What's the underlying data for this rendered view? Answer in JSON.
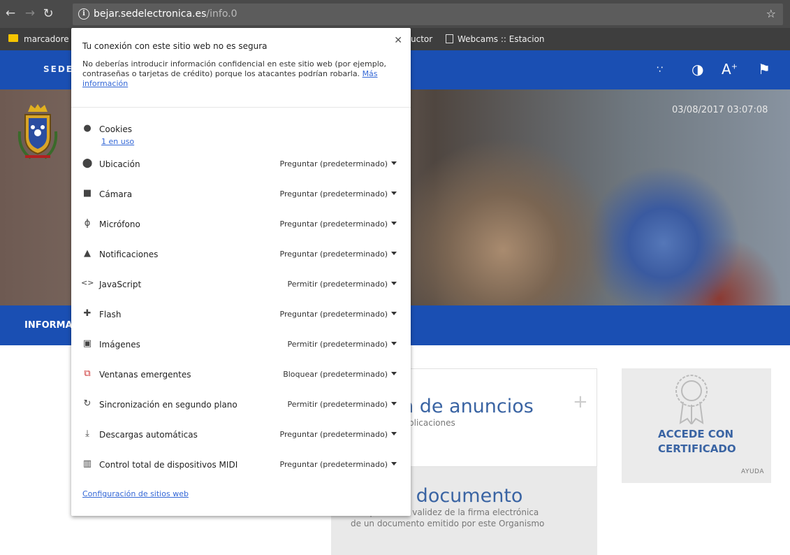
{
  "browser": {
    "url_host": "bejar.sedelectronica.es",
    "url_path": "/info.0",
    "bookmarks": [
      "marcadore",
      "uctor",
      "Webcams :: Estacion"
    ]
  },
  "site": {
    "header_title": "SEDE",
    "datetime": "03/08/2017 03:07:08",
    "nav_label": "INFORMA",
    "card1": {
      "title": "n de anuncios",
      "subtitle": "plicaciones"
    },
    "card2": {
      "title": "r documento",
      "subtitle_line1": "Compruebe la validez de la firma electrónica",
      "subtitle_line2": "de un documento emitido por este Organismo"
    },
    "cert": {
      "line1": "ACCEDE CON",
      "line2": "CERTIFICADO",
      "help": "AYUDA"
    }
  },
  "popup": {
    "title": "Tu conexión con este sitio web no es segura",
    "description": "No deberías introducir información confidencial en este sitio web (por ejemplo, contraseñas o tarjetas de crédito) porque los atacantes podrían robarla.",
    "more_info": "Más información",
    "cookies": {
      "label": "Cookies",
      "sub": "1 en uso"
    },
    "permissions": [
      {
        "label": "Ubicación",
        "value": "Preguntar (predeterminado)",
        "icon": "location-icon"
      },
      {
        "label": "Cámara",
        "value": "Preguntar (predeterminado)",
        "icon": "camera-icon"
      },
      {
        "label": "Micrófono",
        "value": "Preguntar (predeterminado)",
        "icon": "microphone-icon"
      },
      {
        "label": "Notificaciones",
        "value": "Preguntar (predeterminado)",
        "icon": "bell-icon"
      },
      {
        "label": "JavaScript",
        "value": "Permitir (predeterminado)",
        "icon": "code-icon"
      },
      {
        "label": "Flash",
        "value": "Preguntar (predeterminado)",
        "icon": "puzzle-icon"
      },
      {
        "label": "Imágenes",
        "value": "Permitir (predeterminado)",
        "icon": "image-icon"
      },
      {
        "label": "Ventanas emergentes",
        "value": "Bloquear (predeterminado)",
        "icon": "popup-blocked-icon"
      },
      {
        "label": "Sincronización en segundo plano",
        "value": "Permitir (predeterminado)",
        "icon": "sync-icon"
      },
      {
        "label": "Descargas automáticas",
        "value": "Preguntar (predeterminado)",
        "icon": "download-icon"
      },
      {
        "label": "Control total de dispositivos MIDI",
        "value": "Preguntar (predeterminado)",
        "icon": "midi-icon"
      }
    ],
    "footer_link": "Configuración de sitios web"
  }
}
